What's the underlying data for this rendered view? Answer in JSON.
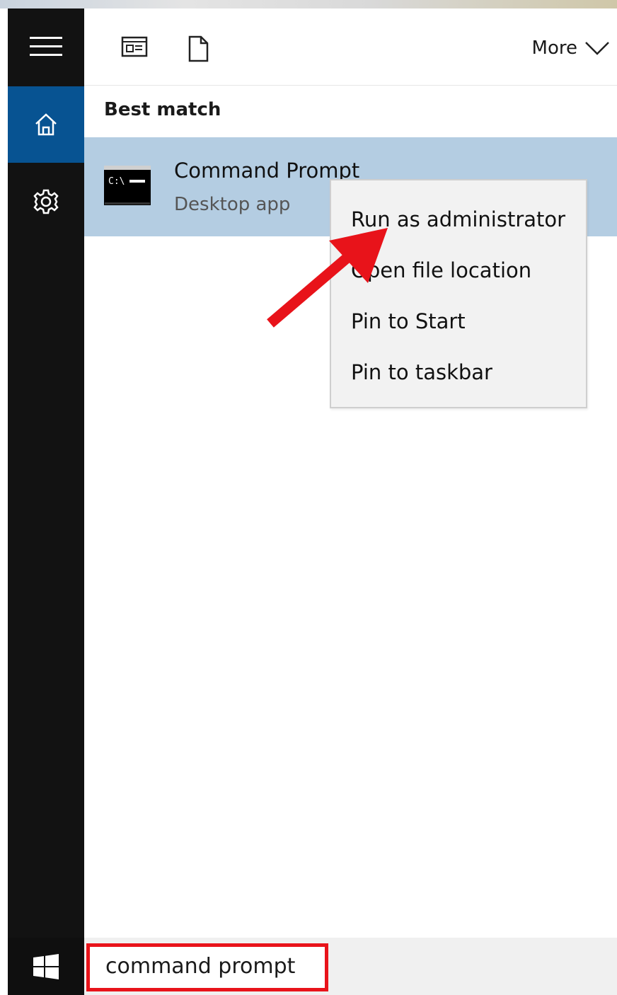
{
  "toolbar": {
    "more_label": "More",
    "icons": [
      "apps-icon",
      "document-icon",
      "chevron-down-icon"
    ]
  },
  "rail": {
    "icons": [
      "hamburger-menu-icon",
      "home-icon",
      "settings-gear-icon"
    ]
  },
  "results": {
    "section_title": "Best match",
    "best_match": {
      "title": "Command Prompt",
      "subtitle": "Desktop app",
      "icon": "command-prompt-icon",
      "icon_text": "C:\\_"
    }
  },
  "context_menu": {
    "items": [
      {
        "label": "Run as administrator"
      },
      {
        "label": "Open file location"
      },
      {
        "label": "Pin to Start"
      },
      {
        "label": "Pin to taskbar"
      }
    ]
  },
  "annotation": {
    "arrow_color": "#e8131a",
    "highlight_color": "#e8131a"
  },
  "taskbar": {
    "search_value": "command prompt",
    "start_icon": "windows-logo-icon"
  },
  "colors": {
    "rail_bg": "#121212",
    "home_selected": "#075392",
    "result_highlight": "#b4cde2",
    "menu_bg": "#f2f2f2"
  }
}
